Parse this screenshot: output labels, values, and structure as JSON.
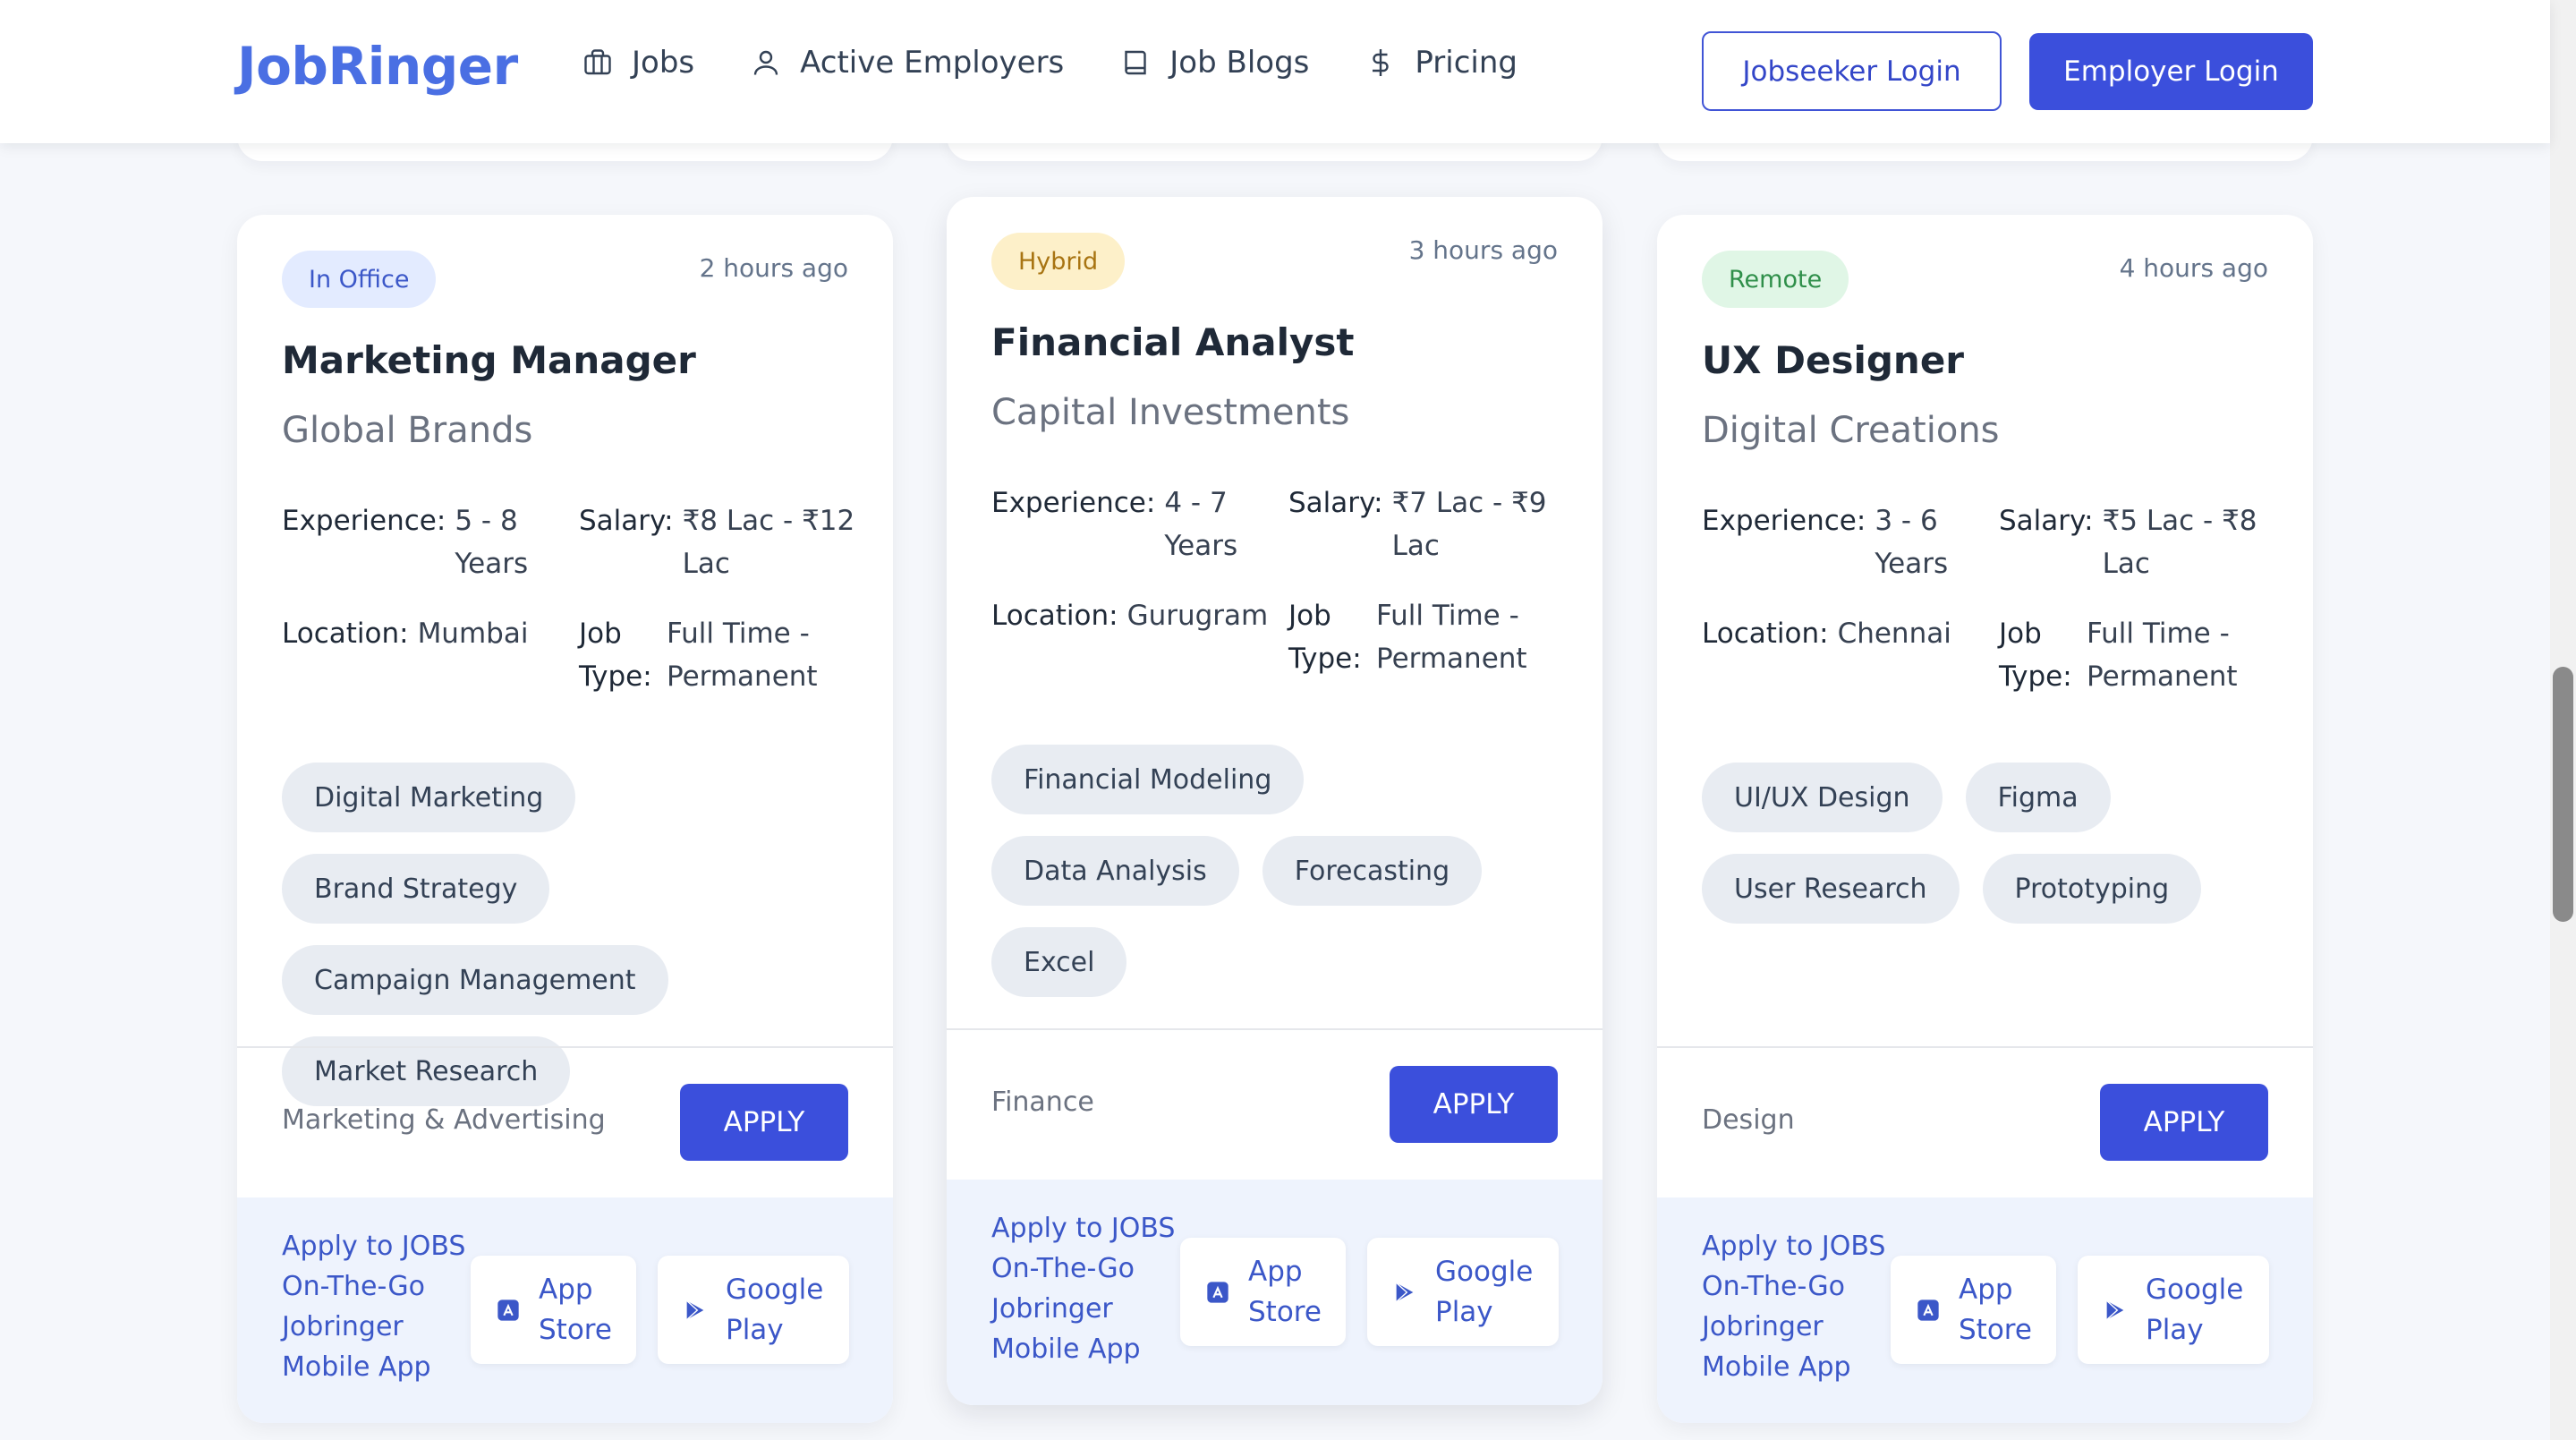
{
  "header": {
    "logo": "JobRinger",
    "nav": [
      {
        "label": "Jobs",
        "icon": "briefcase-icon"
      },
      {
        "label": "Active Employers",
        "icon": "user-icon"
      },
      {
        "label": "Job Blogs",
        "icon": "book-icon"
      },
      {
        "label": "Pricing",
        "icon": "dollar-icon"
      }
    ],
    "jobseeker_login": "Jobseeker Login",
    "employer_login": "Employer Login"
  },
  "labels": {
    "experience": "Experience:",
    "salary": "Salary:",
    "location": "Location:",
    "job_type": "Job Type:",
    "apply": "APPLY",
    "app_promo": "Apply to JOBS On-The-Go Jobringer Mobile App",
    "app_store": "App Store",
    "google_play": "Google Play"
  },
  "cards": [
    {
      "badge": "In Office",
      "time": "2 hours ago",
      "title": "Marketing Manager",
      "company": "Global Brands",
      "experience": "5 - 8 Years",
      "salary": "₹8 Lac - ₹12 Lac",
      "location": "Mumbai",
      "job_type": "Full Time - Permanent",
      "skills": [
        "Digital Marketing",
        "Brand Strategy",
        "Campaign Management",
        "Market Research"
      ],
      "category": "Marketing & Advertising"
    },
    {
      "badge": "Hybrid",
      "time": "3 hours ago",
      "title": "Financial Analyst",
      "company": "Capital Investments",
      "experience": "4 - 7 Years",
      "salary": "₹7 Lac - ₹9 Lac",
      "location": "Gurugram",
      "job_type": "Full Time - Permanent",
      "skills": [
        "Financial Modeling",
        "Data Analysis",
        "Forecasting",
        "Excel"
      ],
      "category": "Finance"
    },
    {
      "badge": "Remote",
      "time": "4 hours ago",
      "title": "UX Designer",
      "company": "Digital Creations",
      "experience": "3 - 6 Years",
      "salary": "₹5 Lac - ₹8 Lac",
      "location": "Chennai",
      "job_type": "Full Time - Permanent",
      "skills": [
        "UI/UX Design",
        "Figma",
        "User Research",
        "Prototyping"
      ],
      "category": "Design"
    }
  ],
  "colors": {
    "brand": "#4a6fe3",
    "primary_button": "#3b4fdc",
    "office_badge": "#e3ebff",
    "hybrid_badge": "#fdf0c9",
    "remote_badge": "#e0f6e6"
  }
}
